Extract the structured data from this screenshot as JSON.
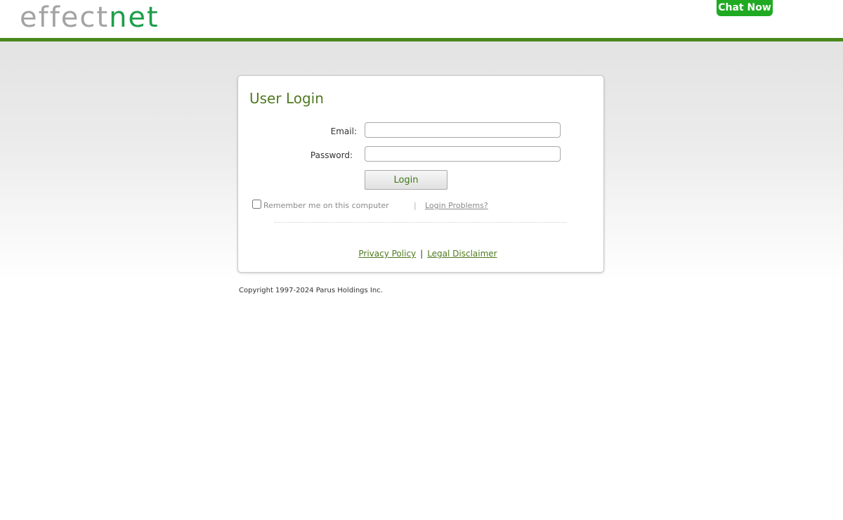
{
  "header": {
    "logo_part1": "effect",
    "logo_part2": "net",
    "chat_label": "Chat Now"
  },
  "login": {
    "title": "User Login",
    "email_label": "Email:",
    "email_value": "",
    "password_label": "Password:",
    "password_value": "",
    "login_button": "Login",
    "remember_label": "Remember me on this computer",
    "remember_checked": false,
    "separator": "|",
    "login_problems": "Login Problems?"
  },
  "footer": {
    "privacy_policy": "Privacy Policy",
    "separator": "|",
    "legal_disclaimer": "Legal Disclaimer",
    "copyright": "Copyright 1997-2024 Parus Holdings Inc."
  },
  "colors": {
    "brand_green": "#4a8a1c",
    "logo_green": "#1e9e4a",
    "logo_gray": "#a3a3a3",
    "chat_green": "#1faa22",
    "title_green": "#4f7a1f"
  }
}
